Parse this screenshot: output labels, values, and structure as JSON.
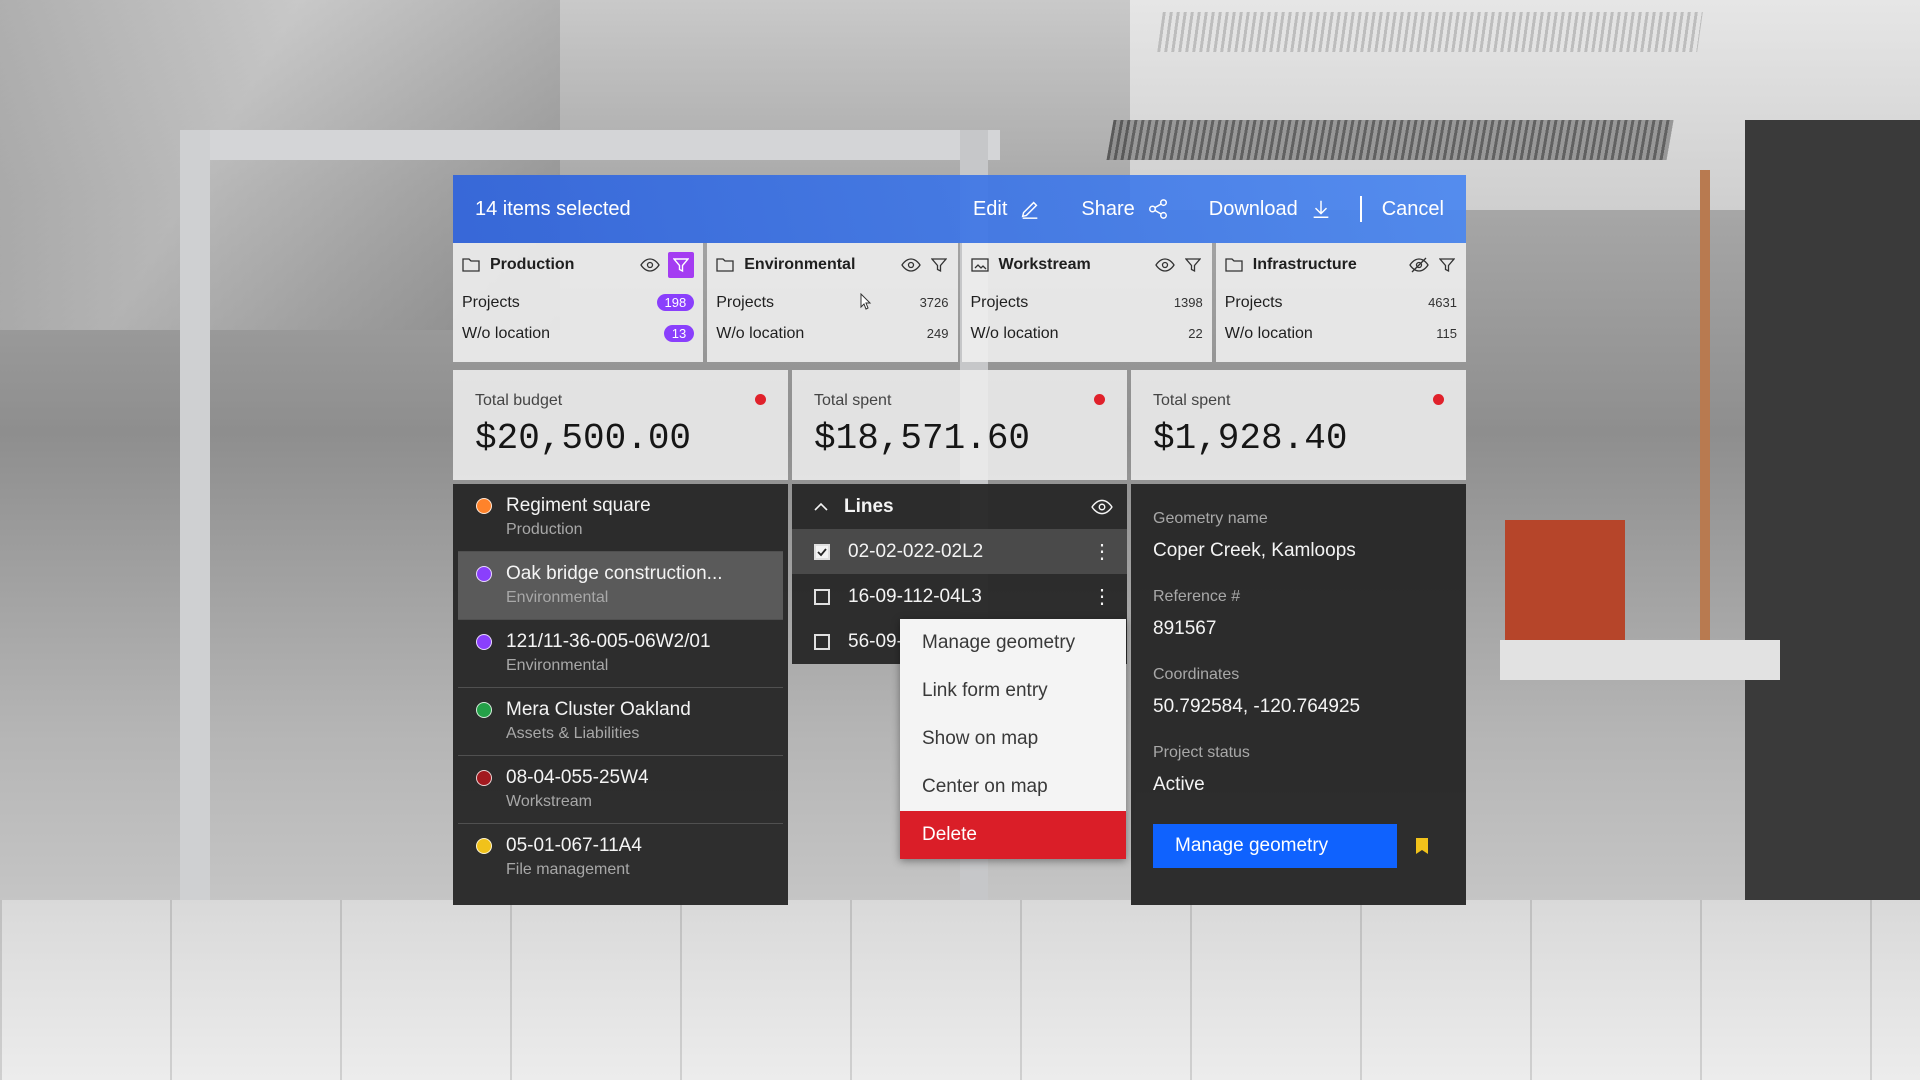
{
  "colors": {
    "accent": "#0f62fe",
    "purple": "#8a3ffc",
    "danger": "#da1e28",
    "alert_dot": "#e0212b"
  },
  "topbar": {
    "selection": "14 items selected",
    "edit": "Edit",
    "share": "Share",
    "download": "Download",
    "cancel": "Cancel",
    "icons": {
      "edit": "pencil-icon",
      "share": "share-icon",
      "download": "download-icon"
    }
  },
  "categories": [
    {
      "name": "Production",
      "projects_label": "Projects",
      "projects": "198",
      "woloc_label": "W/o location",
      "woloc": "13",
      "highlighted": true,
      "icon": "folder-icon",
      "visibility_icon": "eye-icon",
      "filter_active": true
    },
    {
      "name": "Environmental",
      "projects_label": "Projects",
      "projects": "3726",
      "woloc_label": "W/o location",
      "woloc": "249",
      "highlighted": false,
      "icon": "folder-icon",
      "visibility_icon": "eye-icon",
      "filter_active": false
    },
    {
      "name": "Workstream",
      "projects_label": "Projects",
      "projects": "1398",
      "woloc_label": "W/o location",
      "woloc": "22",
      "highlighted": false,
      "icon": "image-folder-icon",
      "visibility_icon": "eye-icon",
      "filter_active": false
    },
    {
      "name": "Infrastructure",
      "projects_label": "Projects",
      "projects": "4631",
      "woloc_label": "W/o location",
      "woloc": "115",
      "highlighted": false,
      "icon": "folder-icon",
      "visibility_icon": "eye-off-icon",
      "filter_active": false
    }
  ],
  "stats": [
    {
      "label": "Total budget",
      "value": "$20,500.00"
    },
    {
      "label": "Total spent",
      "value": "$18,571.60"
    },
    {
      "label": "Total spent",
      "value": "$1,928.40"
    }
  ],
  "projects": [
    {
      "title": "Regiment square",
      "subtitle": "Production",
      "color": "#ff832b"
    },
    {
      "title": "Oak bridge construction...",
      "subtitle": "Environmental",
      "color": "#8a3ffc",
      "active": true
    },
    {
      "title": "121/11-36-005-06W2/01",
      "subtitle": "Environmental",
      "color": "#8a3ffc"
    },
    {
      "title": "Mera Cluster Oakland",
      "subtitle": "Assets & Liabilities",
      "color": "#24a148"
    },
    {
      "title": "08-04-055-25W4",
      "subtitle": "Workstream",
      "color": "#a2191f"
    },
    {
      "title": "05-01-067-11A4",
      "subtitle": "File management",
      "color": "#f1c21b"
    }
  ],
  "lines": {
    "title": "Lines",
    "items": [
      {
        "code": "02-02-022-02L2",
        "checked": true
      },
      {
        "code": "16-09-112-04L3",
        "checked": false
      },
      {
        "code": "56-09-532-13L1",
        "checked": false,
        "menu_open": true
      }
    ]
  },
  "menu": {
    "items": [
      "Manage geometry",
      "Link form entry",
      "Show on map",
      "Center on map"
    ],
    "danger": "Delete"
  },
  "detail": {
    "geometry_label": "Geometry name",
    "geometry": "Coper Creek, Kamloops",
    "reference_label": "Reference #",
    "reference": "891567",
    "coords_label": "Coordinates",
    "coords": "50.792584, -120.764925",
    "status_label": "Project status",
    "status": "Active",
    "button": "Manage geometry",
    "bookmark_color": "#f1c21b"
  }
}
